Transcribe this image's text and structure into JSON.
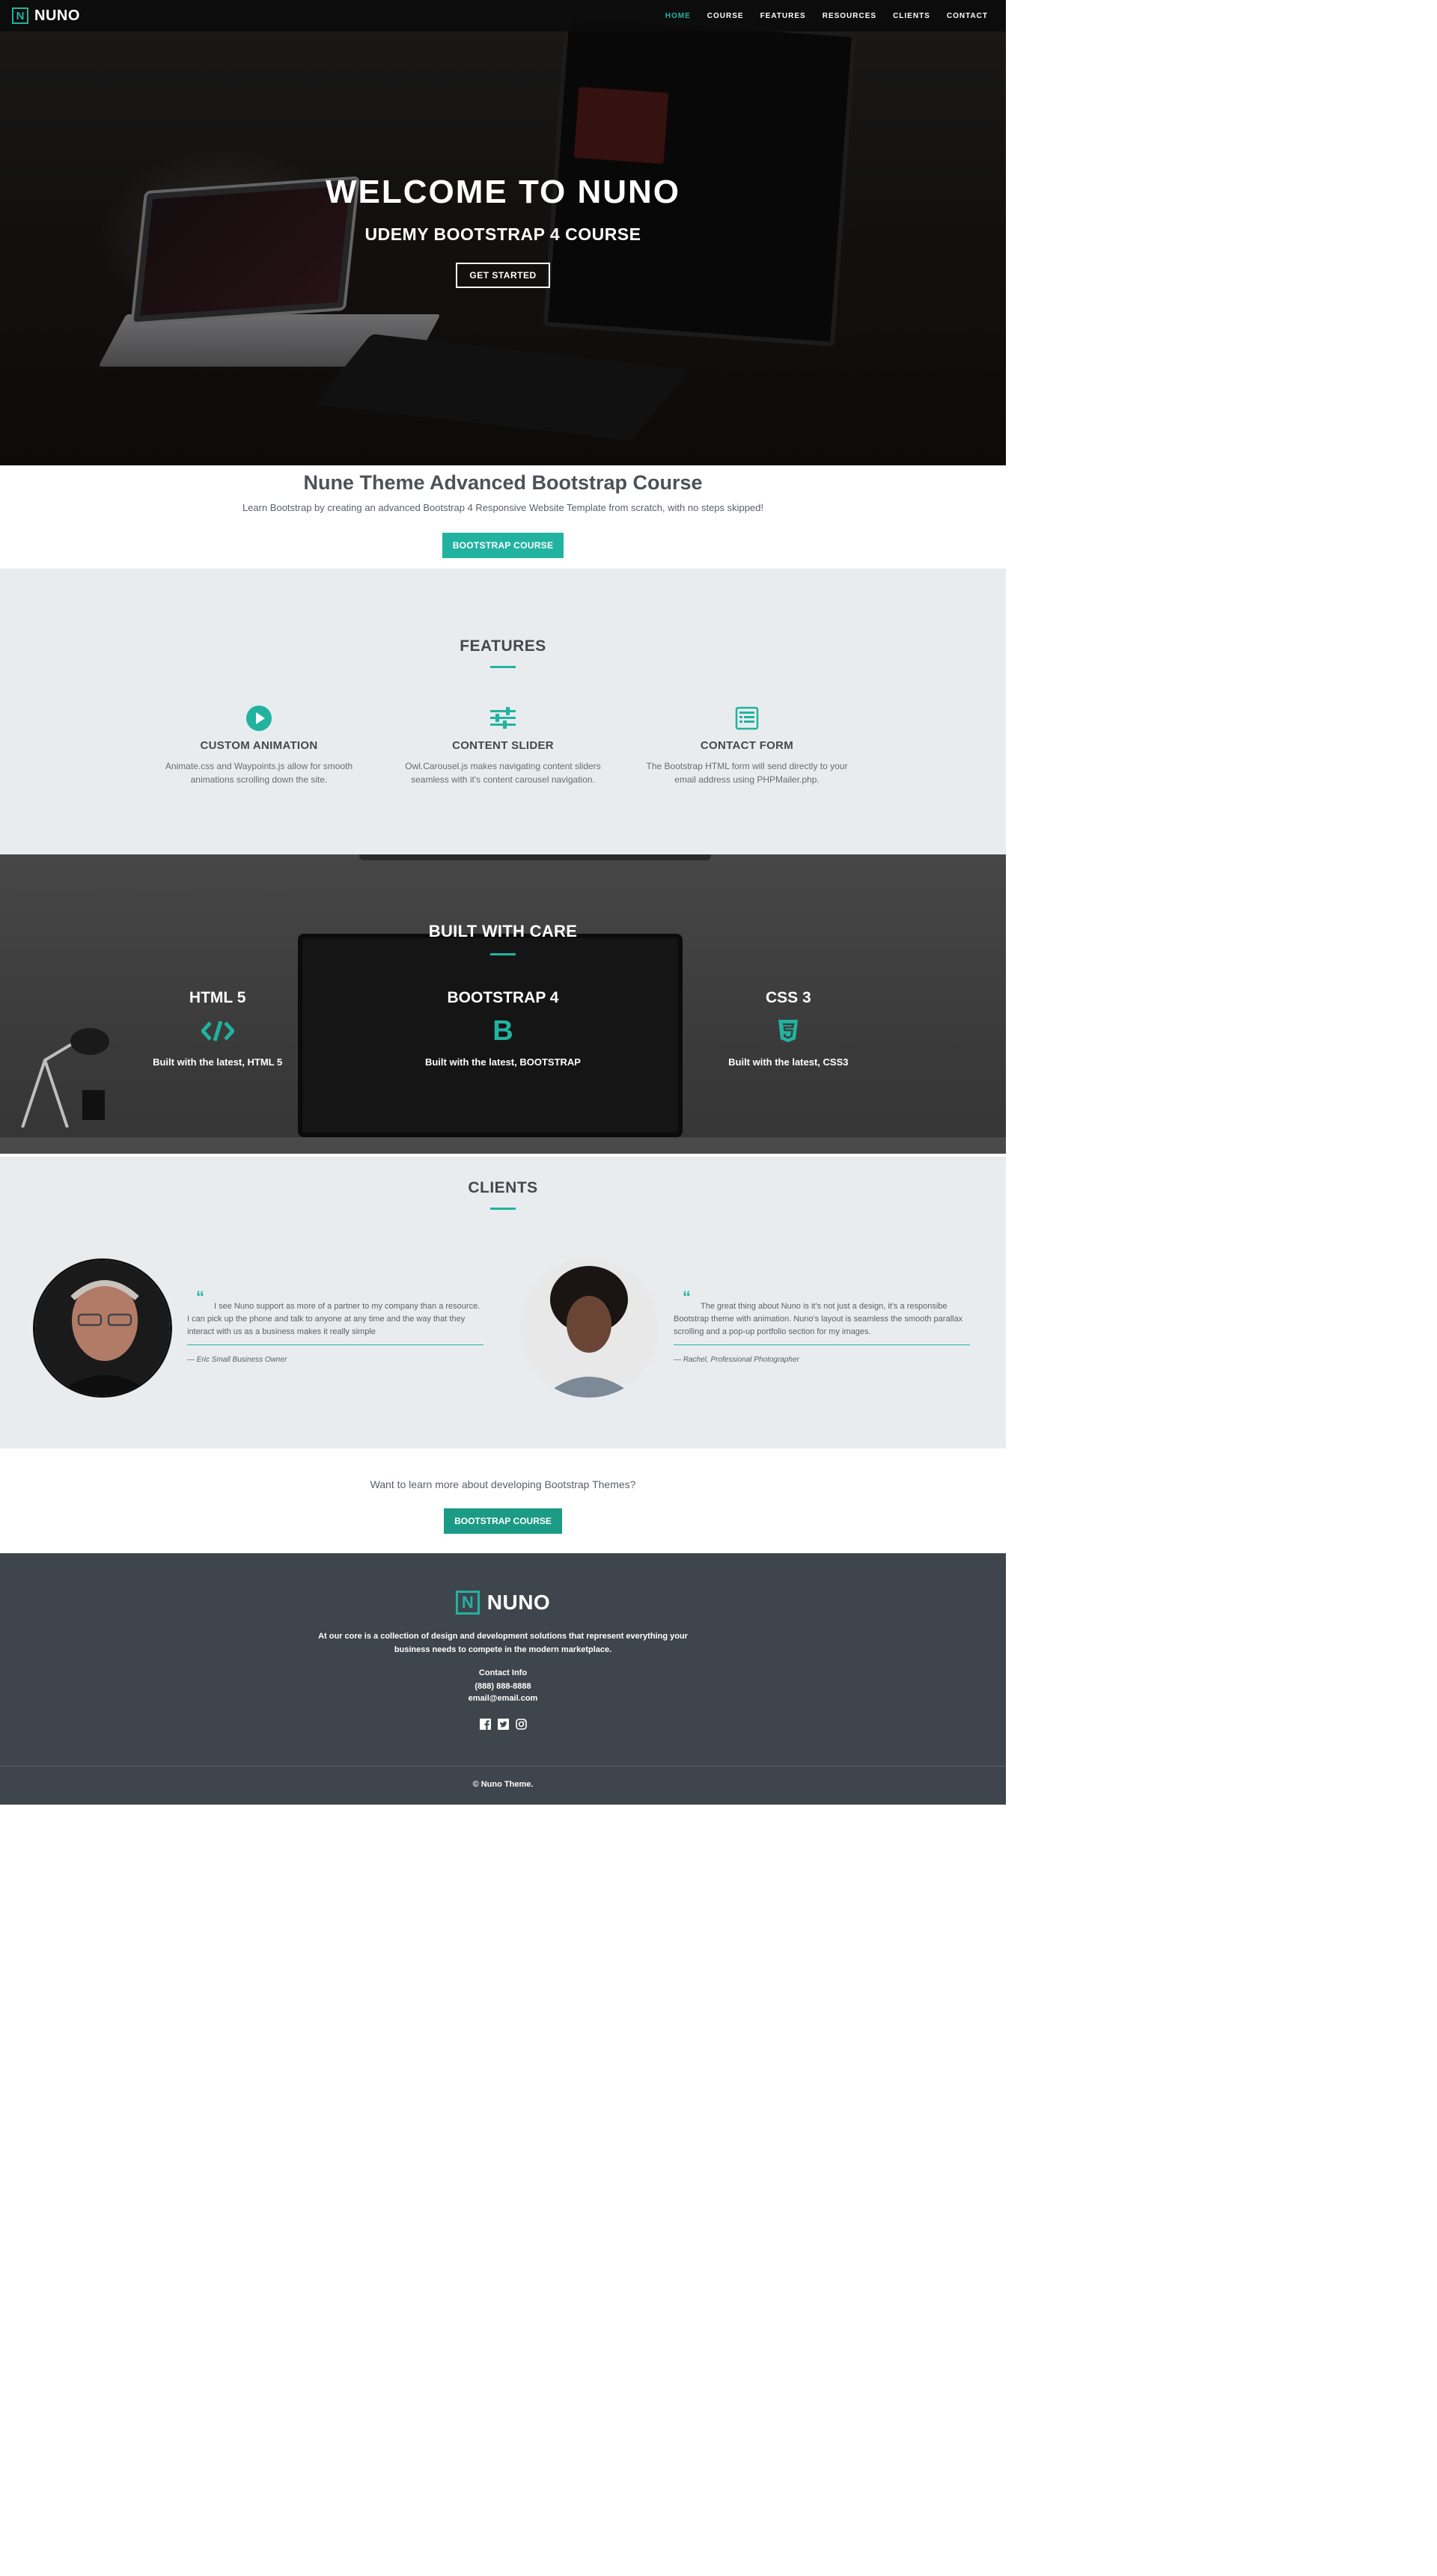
{
  "nav": {
    "brand": "NUNO",
    "logo_letter": "N",
    "links": [
      "HOME",
      "COURSE",
      "FEATURES",
      "RESOURCES",
      "CLIENTS",
      "CONTACT"
    ],
    "active": "HOME"
  },
  "hero": {
    "title": "WELCOME TO NUNO",
    "subtitle": "UDEMY BOOTSTRAP 4 COURSE",
    "button": "GET STARTED"
  },
  "intro": {
    "title": "Nune Theme Advanced Bootstrap Course",
    "text": "Learn Bootstrap by creating an advanced Bootstrap 4 Responsive Website Template from scratch, with no steps skipped!",
    "button": "BOOTSTRAP COURSE"
  },
  "features": {
    "title": "FEATURES",
    "items": [
      {
        "icon": "play-circle-icon",
        "title": "CUSTOM ANIMATION",
        "text": "Animate.css and Waypoints.js allow for smooth animations scrolling down the site."
      },
      {
        "icon": "sliders-icon",
        "title": "CONTENT SLIDER",
        "text": "Owl.Carousel.js makes navigating content sliders seamless with it's content carousel navigation."
      },
      {
        "icon": "form-icon",
        "title": "CONTACT FORM",
        "text": "The Bootstrap HTML form will send directly to your email address using PHPMailer.php."
      }
    ]
  },
  "built": {
    "title": "BUILT WITH CARE",
    "items": [
      {
        "icon": "code-icon",
        "title": "HTML 5",
        "text": "Built with the latest, HTML 5"
      },
      {
        "icon": "bootstrap-icon",
        "title": "BOOTSTRAP 4",
        "text": "Built with the latest, BOOTSTRAP"
      },
      {
        "icon": "css3-icon",
        "title": "CSS 3",
        "text": "Built with the latest, CSS3"
      }
    ]
  },
  "clients": {
    "title": "CLIENTS",
    "testimonials": [
      {
        "quote": "I see Nuno support as more of a partner to my company than a resource. I can pick up the phone and talk to anyone at any time and the way that they interact with us as a business makes it really simple",
        "author": "— Eric Small Business Owner"
      },
      {
        "quote": "The great thing about Nuno is it's not just a design, it's a responsibe Bootstrap theme with animation. Nuno's layout is seamless the smooth parallax scrolling and a pop-up portfolio section for my images.",
        "author": "— Rachel, Professional Photographer"
      }
    ]
  },
  "cta": {
    "text": "Want to learn more about developing Bootstrap Themes?",
    "button": "BOOTSTRAP COURSE"
  },
  "footer": {
    "brand": "NUNO",
    "logo_letter": "N",
    "text": "At our core is a collection of design and development solutions that represent everything your business needs to compete in the modern marketplace.",
    "contact_title": "Contact Info",
    "phone": "(888) 888-8888",
    "email": "email@email.com",
    "social": [
      "facebook-icon",
      "twitter-icon",
      "instagram-icon"
    ],
    "copyright": "© Nuno Theme."
  },
  "colors": {
    "accent": "#22b3a0",
    "accent_dark": "#1b9b86",
    "section_gray": "#e9ecef",
    "footer": "#3f454c"
  }
}
